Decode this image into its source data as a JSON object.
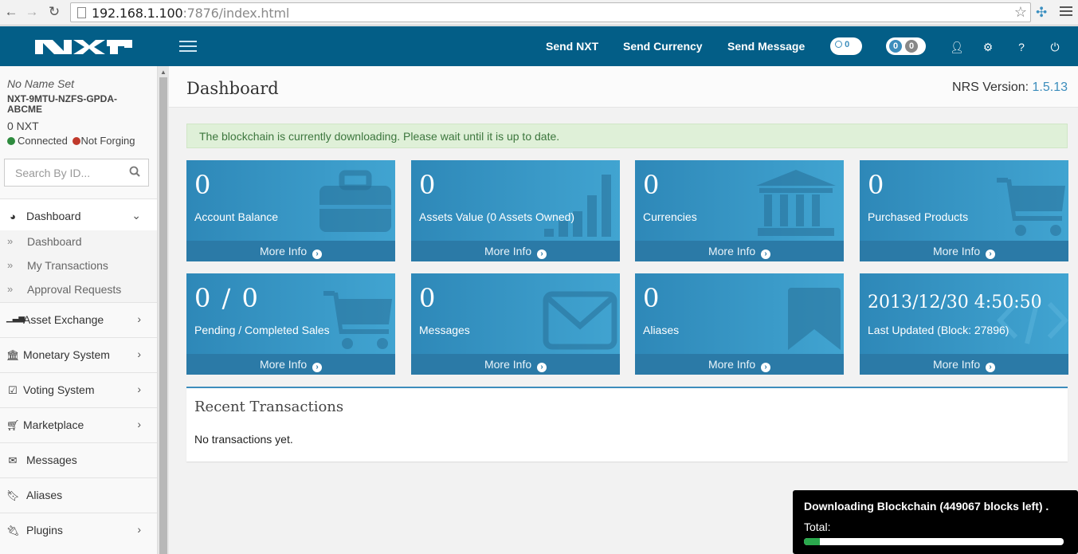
{
  "browser": {
    "url_host": "192.168.1.100",
    "url_rest": ":7876/index.html"
  },
  "header": {
    "links": [
      "Send NXT",
      "Send Currency",
      "Send Message"
    ],
    "pill1_count": "0",
    "pill2_counts": [
      "0",
      "0"
    ]
  },
  "sidebar": {
    "account_name": "No Name Set",
    "account_id": "NXT-9MTU-NZFS-GPDA-ABCME",
    "balance": "0 NXT",
    "connected": "Connected",
    "forging": "Not Forging",
    "search_placeholder": "Search By ID...",
    "dashboard_label": "Dashboard",
    "sub_items": [
      "Dashboard",
      "My Transactions",
      "Approval Requests"
    ],
    "items": [
      "Asset Exchange",
      "Monetary System",
      "Voting System",
      "Marketplace",
      "Messages",
      "Aliases",
      "Plugins"
    ]
  },
  "page": {
    "title": "Dashboard",
    "version_label": "NRS Version:",
    "version_value": "1.5.13",
    "alert": "The blockchain is currently downloading. Please wait until it is up to date.",
    "more_info": "More Info"
  },
  "boxes": [
    {
      "value": "0",
      "label": "Account Balance"
    },
    {
      "value": "0",
      "label": "Assets Value (0 Assets Owned)"
    },
    {
      "value": "0",
      "label": "Currencies"
    },
    {
      "value": "0",
      "label": "Purchased Products"
    },
    {
      "value": "0 / 0",
      "label": "Pending / Completed Sales"
    },
    {
      "value": "0",
      "label": "Messages"
    },
    {
      "value": "0",
      "label": "Aliases"
    },
    {
      "value": "2013/12/30 4:50:50",
      "label": "Last Updated (Block: 27896)"
    }
  ],
  "recent": {
    "title": "Recent Transactions",
    "empty": "No transactions yet."
  },
  "download": {
    "title": "Downloading Blockchain (449067 blocks left) .",
    "total_label": "Total:",
    "progress_fraction": 0.06
  },
  "colors": {
    "header_bg": "#035e87",
    "box_bg": "#2f8dbf",
    "accent": "#3c8dbc",
    "connected": "#2e8b3e",
    "not_forging": "#c0392b"
  }
}
